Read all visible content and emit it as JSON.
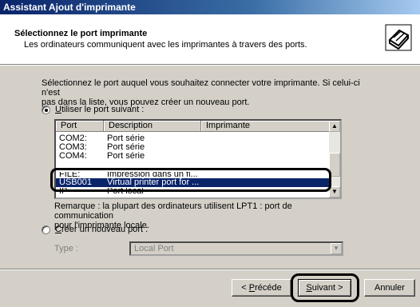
{
  "window": {
    "title": "Assistant Ajout d'imprimante"
  },
  "header": {
    "title": "Sélectionnez le port imprimante",
    "subtitle": "Les ordinateurs communiquent avec les imprimantes à travers des ports."
  },
  "instructions": {
    "line1": "Sélectionnez le port auquel vous souhaitez connecter votre imprimante. Si celui-ci n'est",
    "line2": "pas dans la liste, vous pouvez créer un nouveau port."
  },
  "use_port": {
    "label_u": "U",
    "label_rest": "tiliser le port suivant :",
    "selected": true
  },
  "port_list": {
    "columns": [
      "Port",
      "Description",
      "Imprimante"
    ],
    "rows": [
      {
        "port": "COM2:",
        "description": "Port série",
        "printer": ""
      },
      {
        "port": "COM3:",
        "description": "Port série",
        "printer": ""
      },
      {
        "port": "COM4:",
        "description": "Port série",
        "printer": ""
      },
      {
        "port": "FILE:",
        "description": "Impression dans un fi...",
        "printer": ""
      },
      {
        "port": "USB001",
        "description": "Virtual printer port for ...",
        "printer": ""
      },
      {
        "port": "IP",
        "description": "Port local",
        "printer": ""
      }
    ],
    "selected_port": "USB001"
  },
  "remark": {
    "line1": "Remarque : la plupart des ordinateurs utilisent LPT1 : port de communication",
    "line2": "pour l'imprimante locale."
  },
  "create_port": {
    "label_u": "C",
    "label_rest": "réer un nouveau port :",
    "selected": false
  },
  "type_field": {
    "label": "Type :",
    "value": "Local Port"
  },
  "buttons": {
    "back_u": "P",
    "back_pre": "< ",
    "back_rest": "récéde",
    "next_u": "S",
    "next_rest": "uivant >",
    "cancel": "Annuler"
  },
  "colors": {
    "selection": "#0a246a",
    "dialog": "#d4d0c8"
  }
}
